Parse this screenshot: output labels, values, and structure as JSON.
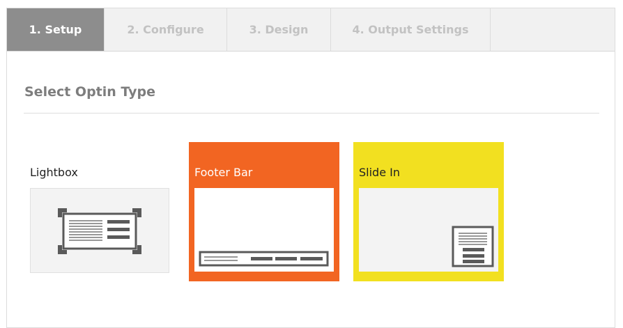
{
  "tabs": [
    {
      "label": "1. Setup",
      "active": true
    },
    {
      "label": "2. Configure",
      "active": false
    },
    {
      "label": "3. Design",
      "active": false
    },
    {
      "label": "4. Output Settings",
      "active": false
    }
  ],
  "section": {
    "title": "Select Optin Type"
  },
  "optin_types": [
    {
      "label": "Lightbox",
      "icon": "lightbox-layout-icon",
      "color": "#ffffff"
    },
    {
      "label": "Footer Bar",
      "icon": "footer-bar-layout-icon",
      "color": "#f26522"
    },
    {
      "label": "Slide In",
      "icon": "slide-in-layout-icon",
      "color": "#f2e020"
    }
  ],
  "colors": {
    "active_tab": "#8d8d8d",
    "icon_gray": "#5a5a5a"
  }
}
